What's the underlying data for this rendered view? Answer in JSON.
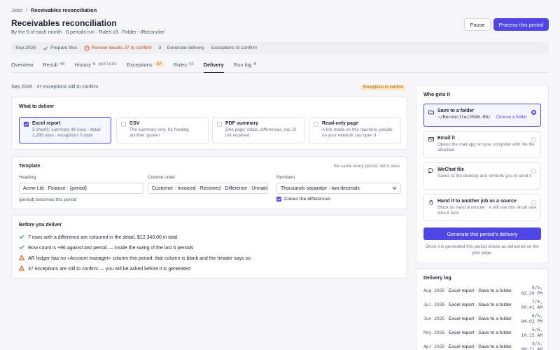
{
  "breadcrumb": {
    "parent": "Jobs",
    "sep": "/",
    "current": "Receivables reconciliation"
  },
  "header": {
    "title": "Receivables reconciliation",
    "subtitle": "By the 5 of each month · 6 periods run · Rules v3 · Folder ~/Reconcile/",
    "pause_label": "Pause",
    "process_label": "Process this period"
  },
  "steps": [
    {
      "label": "Sep 2026",
      "icon": ""
    },
    {
      "label": "Prepare files",
      "icon": "check-icon"
    },
    {
      "label": "Review results  37 to confirm",
      "icon": "alert-circle-icon"
    },
    {
      "label": "Generate delivery",
      "num": "3"
    },
    {
      "label": "Exceptions to confirm",
      "icon": ""
    }
  ],
  "tabs": [
    {
      "label": "Overview",
      "count": ""
    },
    {
      "label": "Result",
      "count": "48"
    },
    {
      "label": "History",
      "count": "6 periods"
    },
    {
      "label": "Exceptions",
      "count": "37"
    },
    {
      "label": "Rules",
      "count": "v3"
    },
    {
      "label": "Delivery",
      "count": ""
    },
    {
      "label": "Run log",
      "count": "6"
    }
  ],
  "status": {
    "line": "Sep 2026 · 37 exceptions still to confirm",
    "badge": "Exceptions to confirm"
  },
  "deliver": {
    "title": "What to deliver",
    "formats": [
      {
        "name": "Excel report",
        "desc": "3 sheets: summary 48 rows · detail 1,286 rows · exceptions 0 rows"
      },
      {
        "name": "CSV",
        "desc": "The summary only, for feeding another system"
      },
      {
        "name": "PDF summary",
        "desc": "One page: totals, differences, top 10 not received"
      },
      {
        "name": "Read-only page",
        "desc": "A link made on this machine; people on your network can open it"
      }
    ]
  },
  "template": {
    "title": "Template",
    "note": "· the same every period, set it once",
    "heading_label": "Heading",
    "heading_value": "Acme Ltd · Finance · {period}",
    "heading_hint": "{period} becomes this period",
    "order_label": "Column order",
    "order_value": "Customer · Invoiced · Received · Difference · Unmatched",
    "numbers_label": "Numbers",
    "numbers_value": "Thousands separator · two decimals",
    "colour_label": "Colour the differences"
  },
  "checks": {
    "title": "Before you deliver",
    "items": [
      {
        "text": "7 rows with a difference are coloured in the detail, $12,340.00 in total",
        "kind": "ok"
      },
      {
        "text": "Row count is +96 against last period — inside the swing of the last 6 periods",
        "kind": "ok"
      },
      {
        "text": "AR ledger has no «Account manager» column this period; that column is blank and the header says so",
        "kind": "warn"
      },
      {
        "text": "37 exceptions are still to confirm — you will be asked before it is generated",
        "kind": "warn"
      }
    ]
  },
  "who": {
    "title": "Who gets it",
    "options": [
      {
        "name": "Save to a folder",
        "path": "~/Reconcile/2026-09/",
        "link": "Choose a folder"
      },
      {
        "name": "Email it",
        "desc": "Opens the mail app on your computer with the file attached"
      },
      {
        "name": "WeChat file",
        "desc": "Saves to the desktop and reminds you to send it"
      },
      {
        "name": "Hand it to another job as a source",
        "desc": "Stock on hand & reorder · it will use this result next time it runs"
      }
    ],
    "generate_label": "Generate this period's delivery",
    "generate_note": "Once it is generated this period shows as delivered on the jobs page."
  },
  "log": {
    "title": "Delivery log",
    "rows": [
      {
        "date": "Aug 2026",
        "what": "Excel report · Save to a folder",
        "time": "8/5, 02:20 PM"
      },
      {
        "date": "Jul 2026",
        "what": "Excel report · Save to a folder",
        "time": "7/4, 09:41 AM"
      },
      {
        "date": "Jun 2026",
        "what": "Excel report · Save to a folder",
        "time": "6/5, 04:02 PM"
      },
      {
        "date": "May 2026",
        "what": "Excel report · Save to a folder",
        "time": "5/6, 10:15 AM"
      },
      {
        "date": "Apr 2026",
        "what": "Excel report · Save to a folder",
        "time": "4/3, 09:11 AM"
      }
    ]
  },
  "colors": {
    "accent": "#4f46e5",
    "ok": "#16a34a",
    "warn": "#d9480f",
    "badge_bg": "#fde7c2"
  }
}
